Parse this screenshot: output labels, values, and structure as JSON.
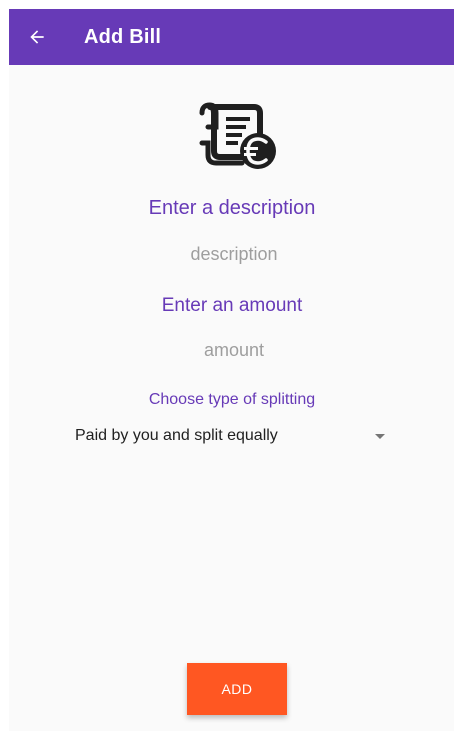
{
  "app_bar": {
    "title": "Add Bill",
    "back_icon": "arrow-back-icon",
    "color": "#673ab7"
  },
  "header_icon": "bill-euro-icon",
  "description": {
    "label": "Enter a description",
    "placeholder": "description",
    "value": ""
  },
  "amount": {
    "label": "Enter an amount",
    "placeholder": "amount",
    "value": ""
  },
  "splitting": {
    "label": "Choose type of splitting",
    "selected": "Paid by you and split equally"
  },
  "add_button": {
    "label": "ADD",
    "color": "#ff5722"
  }
}
